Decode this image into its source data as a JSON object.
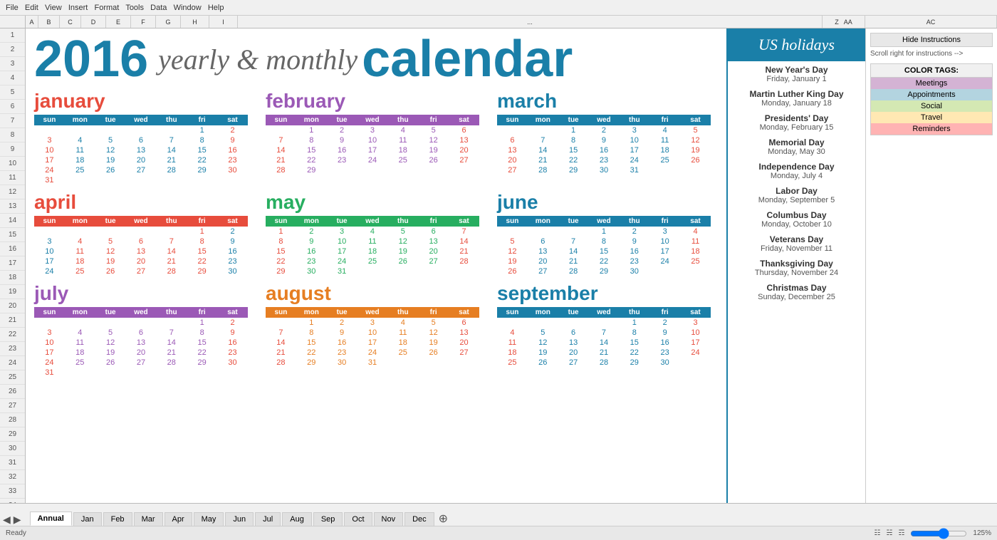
{
  "header": {
    "year": "2016",
    "subtitle": "yearly & monthly",
    "calendar_word": "calendar"
  },
  "toolbar": {
    "hide_instructions": "Hide Instructions",
    "scroll_right": "Scroll right for instructions -->"
  },
  "color_tags": {
    "title": "COLOR TAGS:",
    "items": [
      {
        "label": "Meetings",
        "class": "tag-meetings"
      },
      {
        "label": "Appointments",
        "class": "tag-appointments"
      },
      {
        "label": "Social",
        "class": "tag-social"
      },
      {
        "label": "Travel",
        "class": "tag-travel"
      },
      {
        "label": "Reminders",
        "class": "tag-reminders"
      }
    ]
  },
  "us_holidays": {
    "title": "US holidays",
    "items": [
      {
        "name": "New Year's Day",
        "date": "Friday, January 1"
      },
      {
        "name": "Martin Luther King Day",
        "date": "Monday, January 18"
      },
      {
        "name": "Presidents' Day",
        "date": "Monday, February 15"
      },
      {
        "name": "Memorial Day",
        "date": "Monday, May 30"
      },
      {
        "name": "Independence Day",
        "date": "Monday, July 4"
      },
      {
        "name": "Labor Day",
        "date": "Monday, September 5"
      },
      {
        "name": "Columbus Day",
        "date": "Monday, October 10"
      },
      {
        "name": "Veterans Day",
        "date": "Friday, November 11"
      },
      {
        "name": "Thanksgiving Day",
        "date": "Thursday, November 24"
      },
      {
        "name": "Christmas Day",
        "date": "Sunday, December 25"
      }
    ]
  },
  "months": [
    {
      "id": "jan",
      "name": "january",
      "days": [
        [
          "",
          "",
          "",
          "",
          "",
          "1",
          "2"
        ],
        [
          "3",
          "4",
          "5",
          "6",
          "7",
          "8",
          "9"
        ],
        [
          "10",
          "11",
          "12",
          "13",
          "14",
          "15",
          "16"
        ],
        [
          "17",
          "18",
          "19",
          "20",
          "21",
          "22",
          "23"
        ],
        [
          "24",
          "25",
          "26",
          "27",
          "28",
          "29",
          "30"
        ],
        [
          "31",
          "",
          "",
          "",
          "",
          "",
          ""
        ]
      ]
    },
    {
      "id": "feb",
      "name": "february",
      "days": [
        [
          "",
          "1",
          "2",
          "3",
          "4",
          "5",
          "6"
        ],
        [
          "7",
          "8",
          "9",
          "10",
          "11",
          "12",
          "13"
        ],
        [
          "14",
          "15",
          "16",
          "17",
          "18",
          "19",
          "20"
        ],
        [
          "21",
          "22",
          "23",
          "24",
          "25",
          "26",
          "27"
        ],
        [
          "28",
          "29",
          "",
          "",
          "",
          "",
          ""
        ]
      ]
    },
    {
      "id": "mar",
      "name": "march",
      "days": [
        [
          "",
          "",
          "1",
          "2",
          "3",
          "4",
          "5"
        ],
        [
          "6",
          "7",
          "8",
          "9",
          "10",
          "11",
          "12"
        ],
        [
          "13",
          "14",
          "15",
          "16",
          "17",
          "18",
          "19"
        ],
        [
          "20",
          "21",
          "22",
          "23",
          "24",
          "25",
          "26"
        ],
        [
          "27",
          "28",
          "29",
          "30",
          "31",
          "",
          ""
        ]
      ]
    },
    {
      "id": "apr",
      "name": "april",
      "days": [
        [
          "",
          "",
          "",
          "",
          "",
          "1",
          "2"
        ],
        [
          "3",
          "4",
          "5",
          "6",
          "7",
          "8",
          "9"
        ],
        [
          "10",
          "11",
          "12",
          "13",
          "14",
          "15",
          "16"
        ],
        [
          "17",
          "18",
          "19",
          "20",
          "21",
          "22",
          "23"
        ],
        [
          "24",
          "25",
          "26",
          "27",
          "28",
          "29",
          "30"
        ]
      ]
    },
    {
      "id": "may",
      "name": "may",
      "days": [
        [
          "1",
          "2",
          "3",
          "4",
          "5",
          "6",
          "7"
        ],
        [
          "8",
          "9",
          "10",
          "11",
          "12",
          "13",
          "14"
        ],
        [
          "15",
          "16",
          "17",
          "18",
          "19",
          "20",
          "21"
        ],
        [
          "22",
          "23",
          "24",
          "25",
          "26",
          "27",
          "28"
        ],
        [
          "29",
          "30",
          "31",
          "",
          "",
          "",
          ""
        ]
      ]
    },
    {
      "id": "jun",
      "name": "june",
      "days": [
        [
          "",
          "",
          "",
          "1",
          "2",
          "3",
          "4"
        ],
        [
          "5",
          "6",
          "7",
          "8",
          "9",
          "10",
          "11"
        ],
        [
          "12",
          "13",
          "14",
          "15",
          "16",
          "17",
          "18"
        ],
        [
          "19",
          "20",
          "21",
          "22",
          "23",
          "24",
          "25"
        ],
        [
          "26",
          "27",
          "28",
          "29",
          "30",
          "",
          ""
        ]
      ]
    },
    {
      "id": "jul",
      "name": "july",
      "days": [
        [
          "",
          "",
          "",
          "",
          "",
          "1",
          "2"
        ],
        [
          "3",
          "4",
          "5",
          "6",
          "7",
          "8",
          "9"
        ],
        [
          "10",
          "11",
          "12",
          "13",
          "14",
          "15",
          "16"
        ],
        [
          "17",
          "18",
          "19",
          "20",
          "21",
          "22",
          "23"
        ],
        [
          "24",
          "25",
          "26",
          "27",
          "28",
          "29",
          "30"
        ],
        [
          "31",
          "",
          "",
          "",
          "",
          "",
          ""
        ]
      ]
    },
    {
      "id": "aug",
      "name": "august",
      "days": [
        [
          "",
          "1",
          "2",
          "3",
          "4",
          "5",
          "6"
        ],
        [
          "7",
          "8",
          "9",
          "10",
          "11",
          "12",
          "13"
        ],
        [
          "14",
          "15",
          "16",
          "17",
          "18",
          "19",
          "20"
        ],
        [
          "21",
          "22",
          "23",
          "24",
          "25",
          "26",
          "27"
        ],
        [
          "28",
          "29",
          "30",
          "31",
          "",
          "",
          ""
        ]
      ]
    },
    {
      "id": "sep",
      "name": "september",
      "days": [
        [
          "",
          "",
          "",
          "",
          "1",
          "2",
          "3"
        ],
        [
          "4",
          "5",
          "6",
          "7",
          "8",
          "9",
          "10"
        ],
        [
          "11",
          "12",
          "13",
          "14",
          "15",
          "16",
          "17"
        ],
        [
          "18",
          "19",
          "20",
          "21",
          "22",
          "23",
          "24"
        ],
        [
          "25",
          "26",
          "27",
          "28",
          "29",
          "30",
          ""
        ]
      ]
    }
  ],
  "tabs": [
    "Annual",
    "Jan",
    "Feb",
    "Mar",
    "Apr",
    "May",
    "Jun",
    "Jul",
    "Aug",
    "Sep",
    "Oct",
    "Nov",
    "Dec"
  ],
  "status": {
    "ready": "Ready",
    "zoom": "125%"
  }
}
